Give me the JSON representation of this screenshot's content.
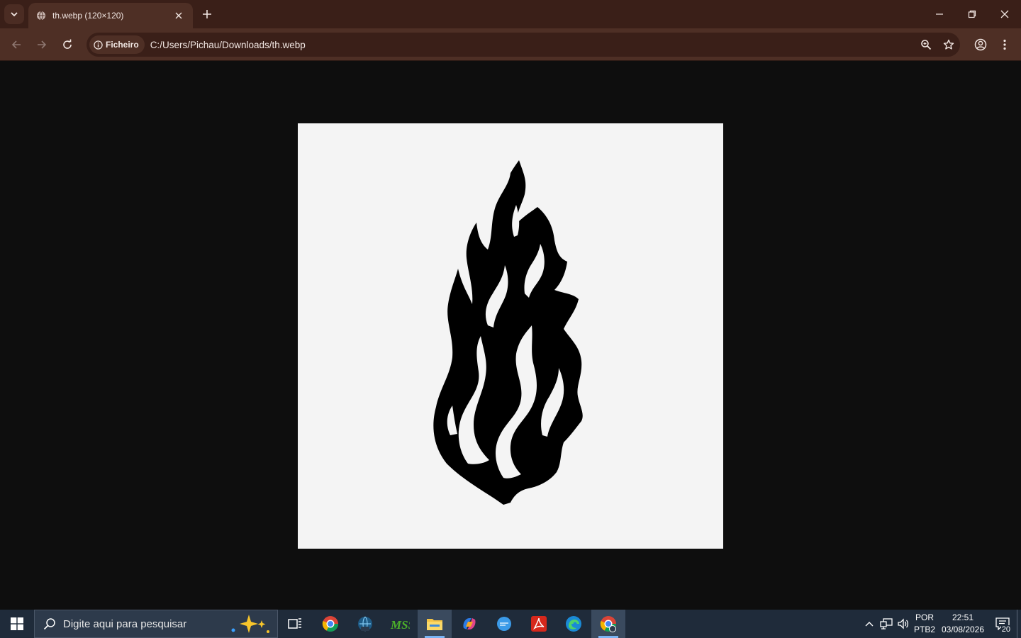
{
  "browser": {
    "tab": {
      "title": "th.webp (120×120)"
    },
    "toolbar": {
      "site_chip_label": "Ficheiro",
      "url": "C:/Users/Pichau/Downloads/th.webp"
    },
    "colors": {
      "frame": "#3a1f18",
      "toolbar": "#4e2f25",
      "text": "#f1e6e2"
    }
  },
  "viewer": {
    "background": "#0e0e0e",
    "image_description_icon": "flame-silhouette"
  },
  "taskbar": {
    "search_placeholder": "Digite aqui para pesquisar",
    "apps": [
      "task-view",
      "chrome",
      "network-app",
      "mss-app",
      "file-explorer",
      "copilot",
      "messaging-app",
      "acrobat",
      "edge",
      "chrome-active"
    ],
    "language": {
      "line1": "POR",
      "line2": "PTB2"
    },
    "clock": {
      "time": "22:51",
      "date": "03/08/2026"
    },
    "notification_count": "20"
  }
}
